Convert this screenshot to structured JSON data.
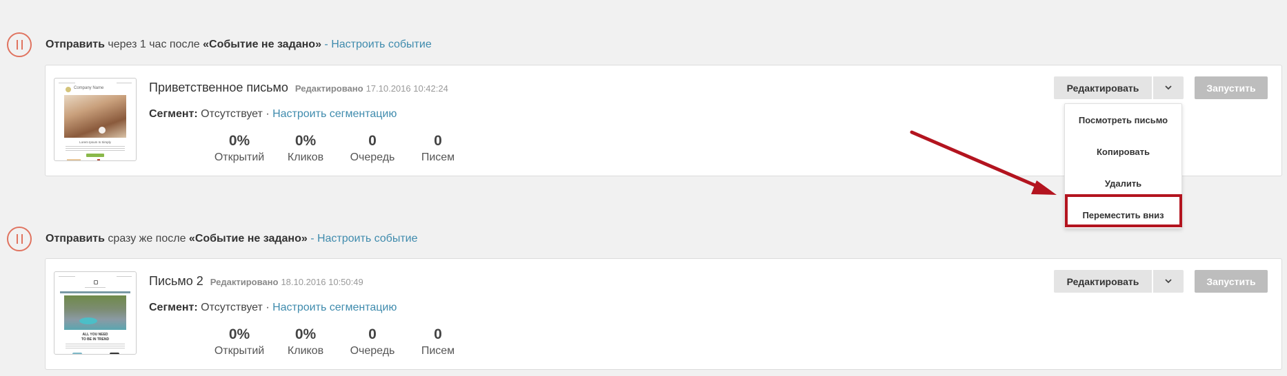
{
  "groups": [
    {
      "trigger": {
        "send_label": "Отправить",
        "timing": " через 1 час после ",
        "event": "«Событие не задано»",
        "separator": " - ",
        "configure_link": "Настроить событие"
      },
      "email": {
        "title": "Приветственное письмо",
        "edited_label": "Редактировано",
        "edited_date": "17.10.2016 10:42:24",
        "segment_label": "Сегмент:",
        "segment_value": " Отсутствует · ",
        "segment_link": "Настроить сегментацию",
        "stats": [
          {
            "value": "0%",
            "label": "Открытий"
          },
          {
            "value": "0%",
            "label": "Кликов"
          },
          {
            "value": "0",
            "label": "Очередь"
          },
          {
            "value": "0",
            "label": "Писем"
          }
        ],
        "edit_button": "Редактировать",
        "run_button": "Запустить"
      }
    },
    {
      "trigger": {
        "send_label": "Отправить",
        "timing": " сразу же после ",
        "event": "«Событие не задано»",
        "separator": " - ",
        "configure_link": "Настроить событие"
      },
      "email": {
        "title": "Письмо 2",
        "edited_label": "Редактировано",
        "edited_date": "18.10.2016 10:50:49",
        "segment_label": "Сегмент:",
        "segment_value": " Отсутствует · ",
        "segment_link": "Настроить сегментацию",
        "stats": [
          {
            "value": "0%",
            "label": "Открытий"
          },
          {
            "value": "0%",
            "label": "Кликов"
          },
          {
            "value": "0",
            "label": "Очередь"
          },
          {
            "value": "0",
            "label": "Писем"
          }
        ],
        "edit_button": "Редактировать",
        "run_button": "Запустить"
      }
    }
  ],
  "dropdown": {
    "items": [
      "Посмотреть письмо",
      "Копировать",
      "Удалить",
      "Переместить вниз"
    ]
  },
  "thumbnails": {
    "first": {
      "brand": "Company Name",
      "headline": "Lorem Ipsum Is Simply"
    },
    "second": {
      "headline_1": "ALL YOU NEED",
      "headline_2": "TO BE IN TREND"
    }
  },
  "icons": {
    "pause": "pause-icon",
    "caret": "chevron-down-icon"
  },
  "colors": {
    "accent": "#e0735f",
    "link": "#3f8bad",
    "highlight": "#b3141f",
    "run_button_disabled": "#bdbdbd"
  }
}
